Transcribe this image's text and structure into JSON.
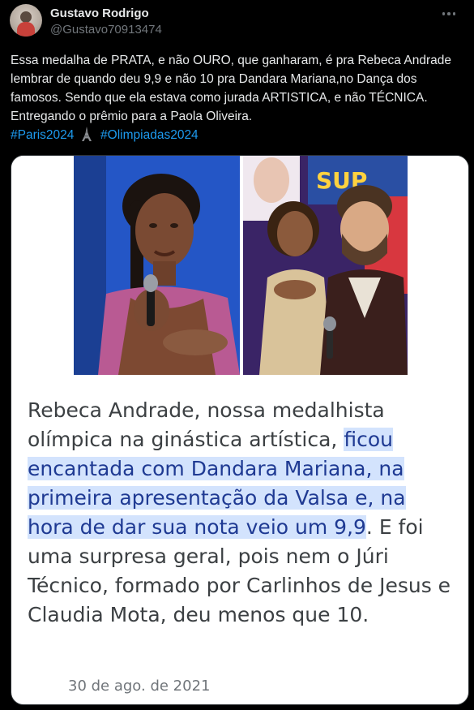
{
  "author": {
    "name": "Gustavo Rodrigo",
    "handle": "@Gustavo70913474"
  },
  "tweet": {
    "text": "Essa medalha de PRATA, e não OURO, que ganharam, é pra Rebeca Andrade lembrar de quando deu 9,9 e não 10 pra Dandara Mariana,no Dança dos famosos. Sendo que ela estava como jurada ARTISTICA,  e não TÉCNICA. Entregando o prêmio para a Paola Oliveira.",
    "hashtags": [
      "#Paris2024",
      "#Olimpiadas2024"
    ]
  },
  "media": {
    "caption_part1": "Rebeca Andrade, nossa medalhista olímpica na ginástica artística, ",
    "caption_highlight": "ficou encantada com Dandara Mariana, na primeira apresentação da Valsa e, na hora de dar sua nota veio um 9,9",
    "caption_part2": ". E foi uma surpresa geral, pois nem o Júri Técnico, formado por Carlinhos de Jesus e Claudia Mota, deu menos que 10.",
    "caption_date": "30 de ago. de 2021",
    "highlight_color": "#d3e3fd"
  },
  "icons": {
    "more": "more-horizontal-icon",
    "emoji": "eiffel-tower-emoji"
  }
}
